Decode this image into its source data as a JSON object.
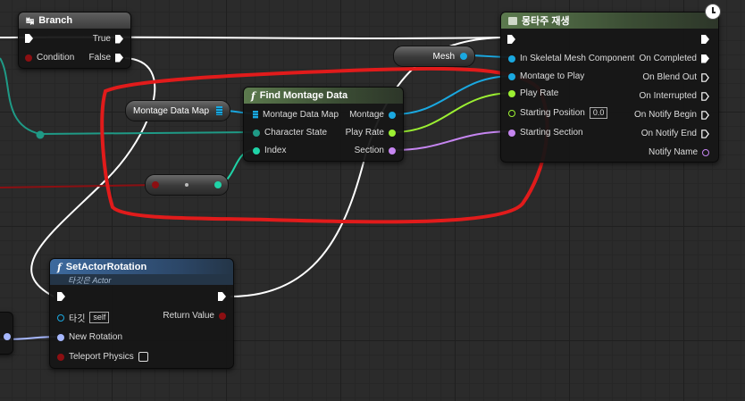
{
  "colors": {
    "exec_wire": "#ffffff",
    "object_pin": "#1aa8e0",
    "float_pin": "#9cf032",
    "name_pin": "#c585f0",
    "struct_pin": "#1fd3a7",
    "bool_pin": "#8c0f12",
    "vector_pin": "#a7b8ff",
    "annotation": "#e11b1b"
  },
  "branch": {
    "title": "Branch",
    "true_label": "True",
    "condition_label": "Condition",
    "false_label": "False"
  },
  "montage": {
    "title": "몽타주 재생",
    "mesh_var": "Mesh",
    "inputs": [
      "In Skeletal Mesh Component",
      "Montage to Play",
      "Play Rate",
      "Starting Position",
      "Starting Section"
    ],
    "starting_position_value": "0.0",
    "outputs": [
      "On Completed",
      "On Blend Out",
      "On Interrupted",
      "On Notify Begin",
      "On Notify End",
      "Notify Name"
    ]
  },
  "find": {
    "title": "Find Montage Data",
    "map_var": "Montage Data Map",
    "inputs": [
      "Montage Data Map",
      "Character State",
      "Index"
    ],
    "outputs": [
      "Montage",
      "Play Rate",
      "Section"
    ]
  },
  "rotation": {
    "title": "SetActorRotation",
    "subtitle": "타깃은 Actor",
    "target_label": "타깃",
    "target_value": "self",
    "return_label": "Return Value",
    "new_rotation_label": "New Rotation",
    "teleport_label": "Teleport Physics"
  }
}
